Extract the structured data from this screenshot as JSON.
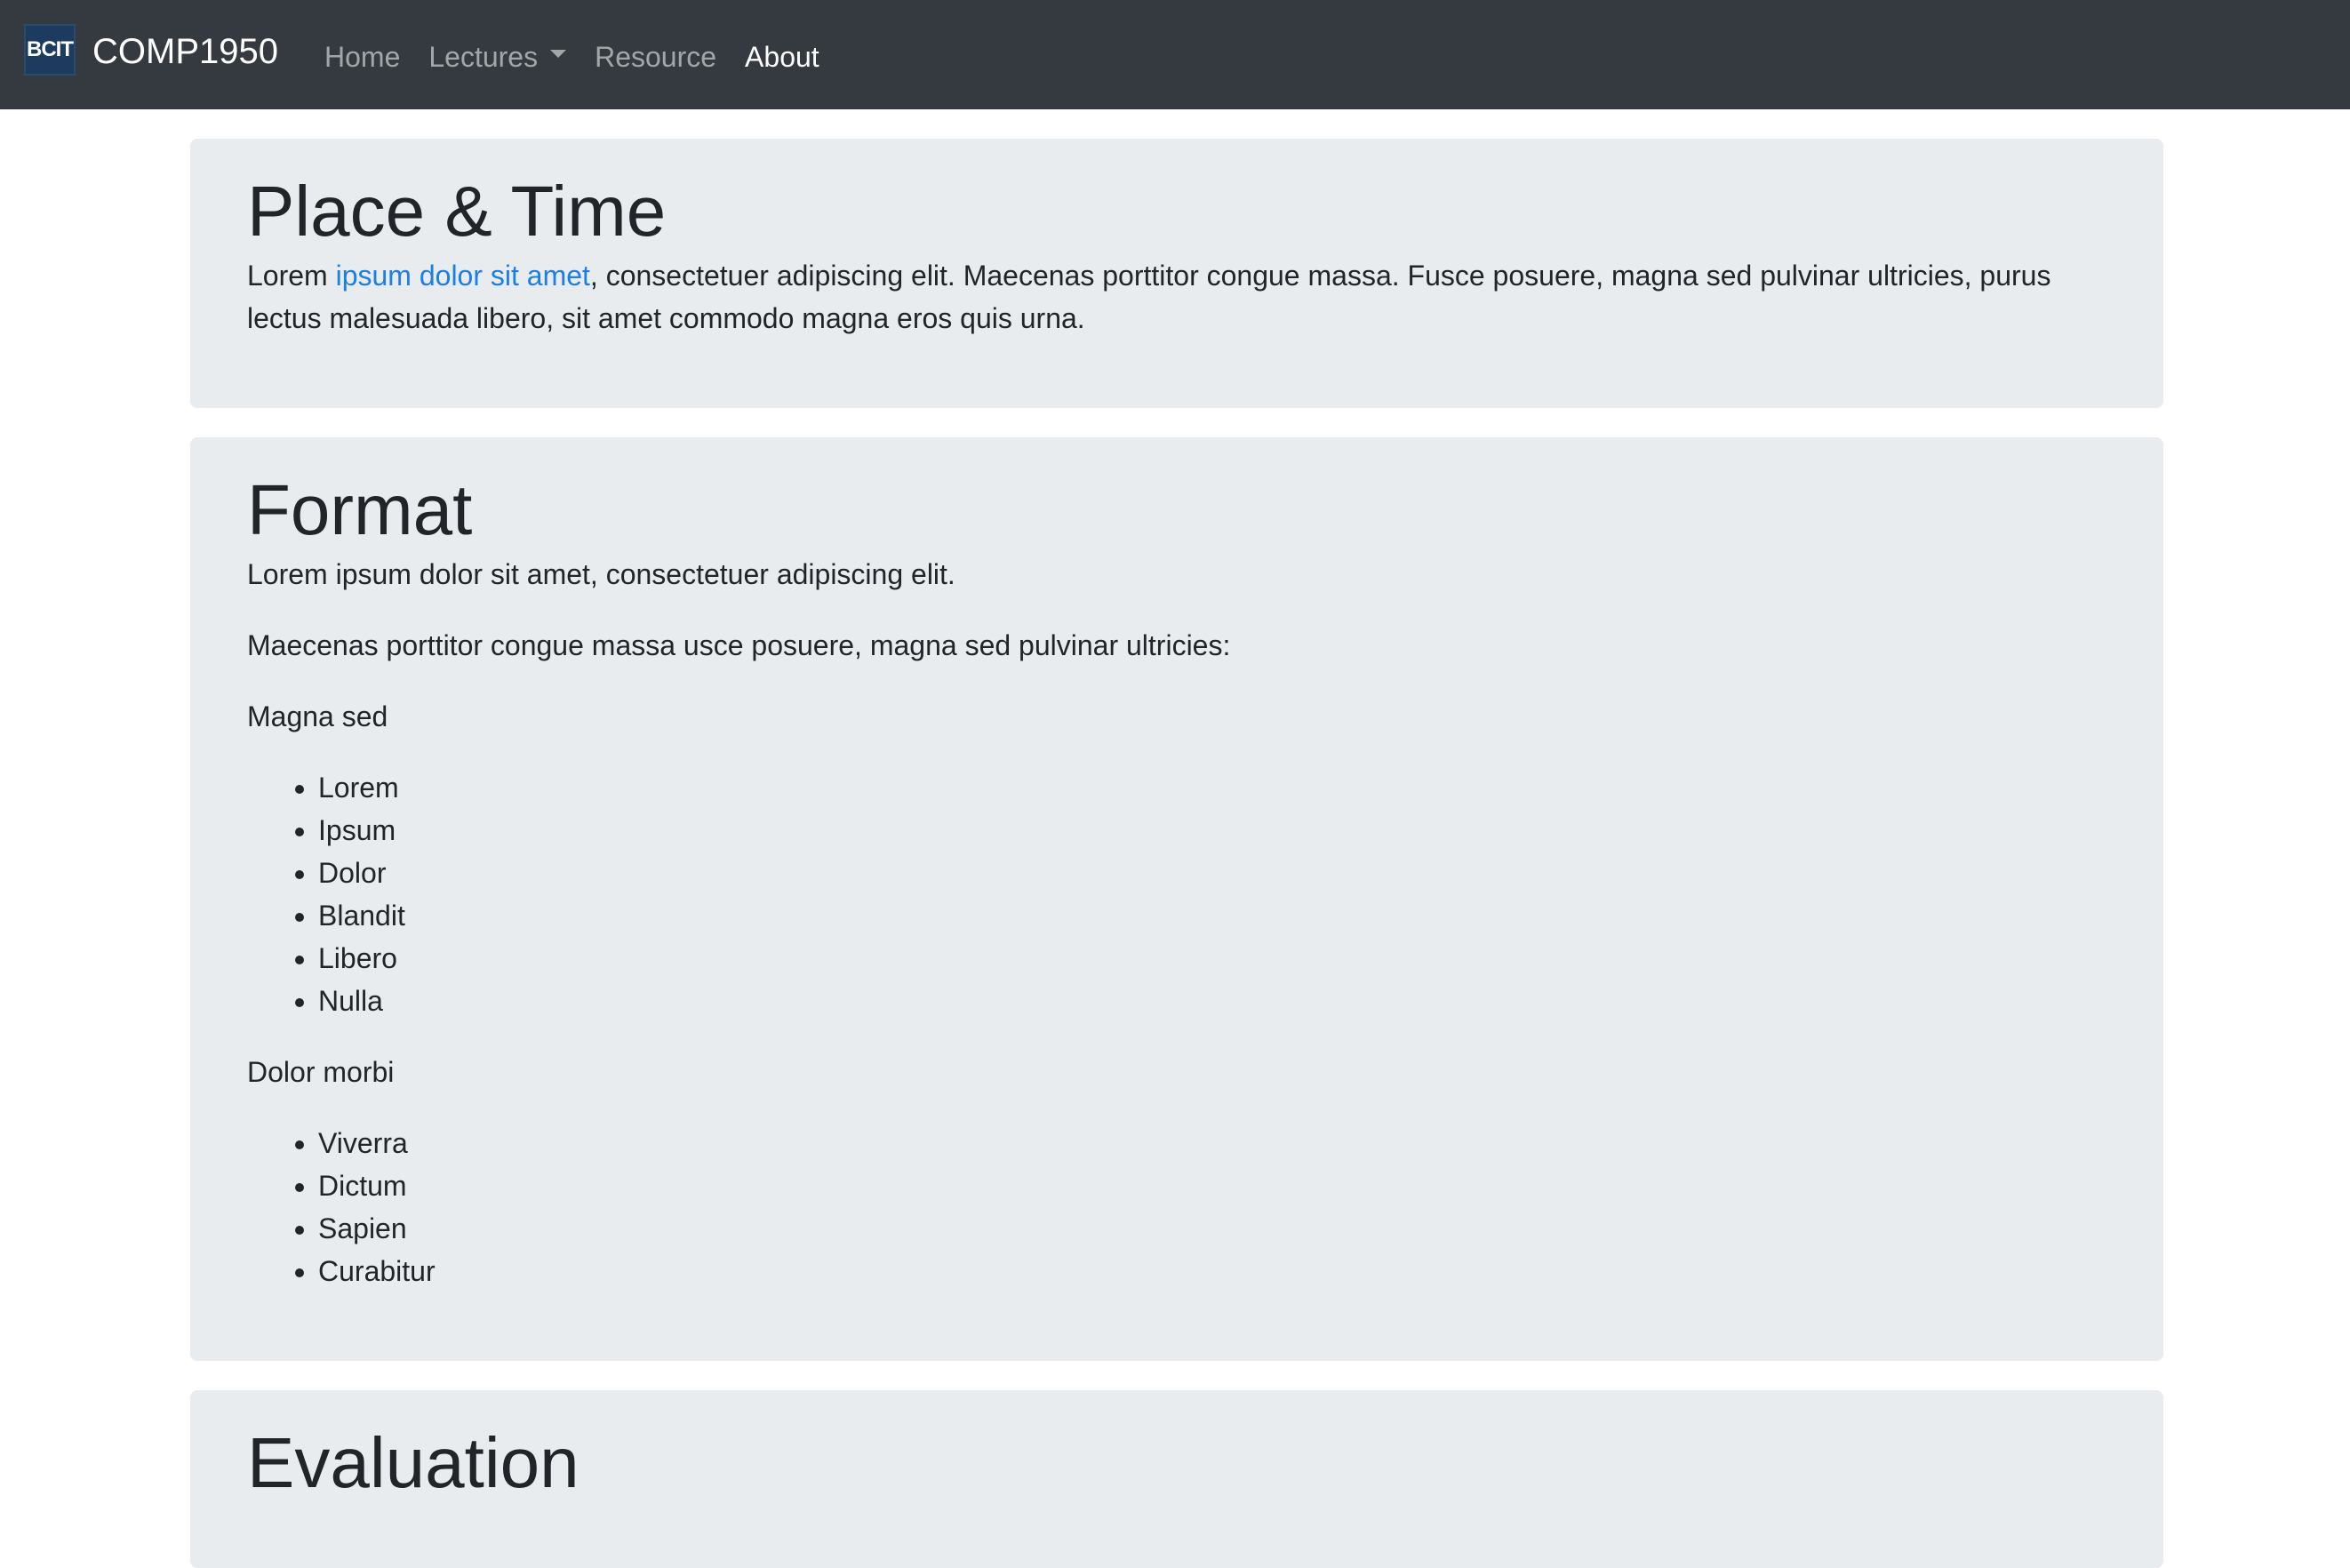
{
  "navbar": {
    "logo_text": "BCIT",
    "brand": "COMP1950",
    "links": [
      {
        "label": "Home"
      },
      {
        "label": "Lectures"
      },
      {
        "label": "Resource"
      },
      {
        "label": "About"
      }
    ]
  },
  "place_time": {
    "title": "Place & Time",
    "text_before_link": "Lorem ",
    "link_text": "ipsum dolor sit amet",
    "text_after_link": ", consectetuer adipiscing elit. Maecenas porttitor congue massa. Fusce posuere, magna sed pulvinar ultricies, purus lectus malesuada libero, sit amet commodo magna eros quis urna."
  },
  "format": {
    "title": "Format",
    "intro": "Lorem ipsum dolor sit amet, consectetuer adipiscing elit.",
    "lead": "Maecenas porttitor congue massa usce posuere, magna sed pulvinar ultricies:",
    "group1_title": "Magna sed",
    "group1_items": [
      "Lorem",
      "Ipsum",
      "Dolor",
      "Blandit",
      "Libero",
      "Nulla"
    ],
    "group2_title": "Dolor morbi",
    "group2_items": [
      "Viverra",
      "Dictum",
      "Sapien",
      "Curabitur"
    ]
  },
  "evaluation": {
    "title": "Evaluation"
  }
}
